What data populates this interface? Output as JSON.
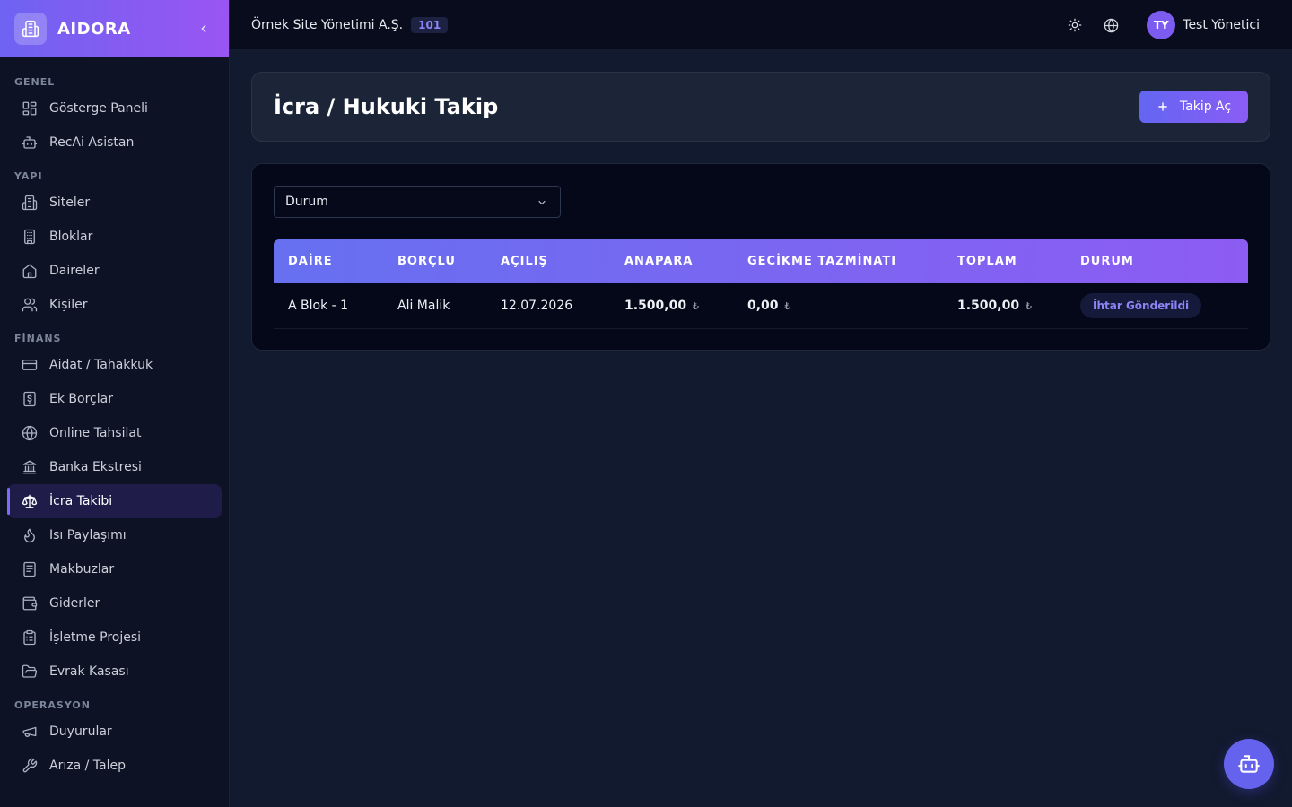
{
  "brand": {
    "name": "AIDORA"
  },
  "sidebar": {
    "sections": [
      {
        "label": "GENEL",
        "items": [
          {
            "label": "Gösterge Paneli",
            "icon": "dashboard-icon"
          },
          {
            "label": "RecAi Asistan",
            "icon": "bot-icon"
          }
        ]
      },
      {
        "label": "YAPI",
        "items": [
          {
            "label": "Siteler",
            "icon": "building-icon"
          },
          {
            "label": "Bloklar",
            "icon": "apartment-block-icon"
          },
          {
            "label": "Daireler",
            "icon": "home-icon"
          },
          {
            "label": "Kişiler",
            "icon": "users-icon"
          }
        ]
      },
      {
        "label": "FİNANS",
        "items": [
          {
            "label": "Aidat / Tahakkuk",
            "icon": "credit-card-icon"
          },
          {
            "label": "Ek Borçlar",
            "icon": "dollar-receipt-icon"
          },
          {
            "label": "Online Tahsilat",
            "icon": "globe-icon"
          },
          {
            "label": "Banka Ekstresi",
            "icon": "bank-icon"
          },
          {
            "label": "İcra Takibi",
            "icon": "scales-icon",
            "active": true
          },
          {
            "label": "Isı Paylaşımı",
            "icon": "flame-icon"
          },
          {
            "label": "Makbuzlar",
            "icon": "receipt-icon"
          },
          {
            "label": "Giderler",
            "icon": "wallet-icon"
          },
          {
            "label": "İşletme Projesi",
            "icon": "clipboard-icon"
          },
          {
            "label": "Evrak Kasası",
            "icon": "folder-open-icon"
          }
        ]
      },
      {
        "label": "OPERASYON",
        "items": [
          {
            "label": "Duyurular",
            "icon": "megaphone-icon"
          },
          {
            "label": "Arıza / Talep",
            "icon": "wrench-icon"
          }
        ]
      }
    ]
  },
  "topbar": {
    "org_name": "Örnek Site Yönetimi A.Ş.",
    "org_badge": "101",
    "user_initials": "TY",
    "user_name": "Test Yönetici"
  },
  "page": {
    "title": "İcra / Hukuki Takip",
    "primary_button": "Takip Aç",
    "filter_placeholder": "Durum"
  },
  "table": {
    "columns": [
      "DAİRE",
      "BORÇLU",
      "AÇILIŞ",
      "ANAPARA",
      "GECİKME TAZMİNATI",
      "TOPLAM",
      "DURUM"
    ],
    "rows": [
      {
        "daire": "A Blok - 1",
        "borclu": "Ali Malik",
        "acilis": "12.07.2026",
        "anapara": "1.500,00",
        "gecikme": "0,00",
        "toplam": "1.500,00",
        "durum": "İhtar Gönderildi"
      }
    ],
    "currency": "₺"
  },
  "colors": {
    "accent": "#6366f1",
    "accent2": "#8b5cf6",
    "sidebar_bg": "#0d1224",
    "main_bg": "#111a2e"
  }
}
